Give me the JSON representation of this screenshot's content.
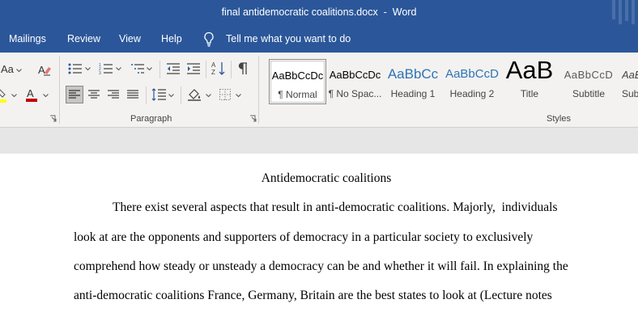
{
  "window": {
    "title": "final antidemocratic coalitions.docx  -  Word"
  },
  "tabs": [
    {
      "label": "Mailings"
    },
    {
      "label": "Review"
    },
    {
      "label": "View"
    },
    {
      "label": "Help"
    }
  ],
  "tell_me": {
    "label": "Tell me what you want to do",
    "icon": "lightbulb-icon"
  },
  "ribbon": {
    "font_partial": {
      "case_label": "Aa",
      "highlight_color": "#ffff00",
      "font_color": "#c00000"
    },
    "paragraph": {
      "label": "Paragraph"
    },
    "styles": {
      "label": "Styles",
      "items": [
        {
          "preview": "AaBbCcDc",
          "name": "¶ Normal",
          "selected": true
        },
        {
          "preview": "AaBbCcDc",
          "name": "¶ No Spac...",
          "selected": false
        },
        {
          "preview": "AaBbCc",
          "name": "Heading 1",
          "selected": false
        },
        {
          "preview": "AaBbCcD",
          "name": "Heading 2",
          "selected": false
        },
        {
          "preview": "AaB",
          "name": "Title",
          "selected": false
        },
        {
          "preview": "AaBbCcD",
          "name": "Subtitle",
          "selected": false
        },
        {
          "preview": "AaBl",
          "name": "Sub",
          "selected": false
        }
      ],
      "heading_color": "#2e74b5"
    }
  },
  "document": {
    "title": "Antidemocratic coalitions",
    "lines": [
      "There exist several aspects that result in anti-democratic coalitions. Majorly,  individuals",
      "look at are the opponents and supporters of democracy in a particular society to exclusively",
      "comprehend how steady or unsteady a democracy can be and whether it will fail. In explaining the",
      "anti-democratic coalitions France, Germany, Britain are the best states to look at (Lecture notes"
    ]
  }
}
